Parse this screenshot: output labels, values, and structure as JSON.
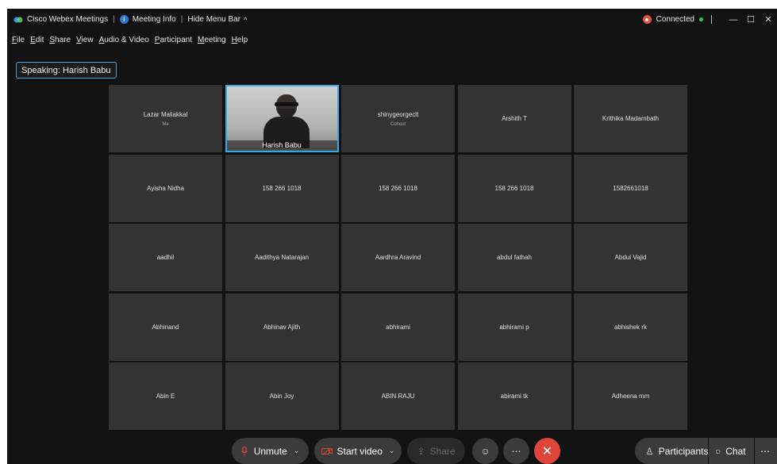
{
  "titlebar": {
    "app_name": "Cisco Webex Meetings",
    "meeting_info": "Meeting Info",
    "hide_menu": "Hide Menu Bar",
    "status": "Connected"
  },
  "menu": [
    "File",
    "Edit",
    "Share",
    "View",
    "Audio & Video",
    "Participant",
    "Meeting",
    "Help"
  ],
  "speaking_label": "Speaking: Harish Babu",
  "tiles": [
    {
      "name": "Lazar Maliakkal",
      "sub": "Me"
    },
    {
      "name": "Harish Babu",
      "sub": "",
      "video": true
    },
    {
      "name": "shinygeorgeclt",
      "sub": "Cohost"
    },
    {
      "name": "Arshith T",
      "sub": ""
    },
    {
      "name": "Krithika Madambath",
      "sub": ""
    },
    {
      "name": "Ayisha Nidha",
      "sub": ""
    },
    {
      "name": "158 266 1018",
      "sub": ""
    },
    {
      "name": "158 266 1018",
      "sub": ""
    },
    {
      "name": "158 266 1018",
      "sub": ""
    },
    {
      "name": "1582661018",
      "sub": ""
    },
    {
      "name": "aadhil",
      "sub": ""
    },
    {
      "name": "Aadithya Natarajan",
      "sub": ""
    },
    {
      "name": "Aardhra Aravind",
      "sub": ""
    },
    {
      "name": "abdul fathah",
      "sub": ""
    },
    {
      "name": "Abdul Vajid",
      "sub": ""
    },
    {
      "name": "Abhinand",
      "sub": ""
    },
    {
      "name": "Abhinav Ajith",
      "sub": ""
    },
    {
      "name": "abhirami",
      "sub": ""
    },
    {
      "name": "abhirami p",
      "sub": ""
    },
    {
      "name": "abhishek rk",
      "sub": ""
    },
    {
      "name": "Abin E",
      "sub": ""
    },
    {
      "name": "Abin Joy",
      "sub": ""
    },
    {
      "name": "ABIN RAJU",
      "sub": ""
    },
    {
      "name": "abirami tk",
      "sub": ""
    },
    {
      "name": "Adheena mm",
      "sub": ""
    }
  ],
  "controls": {
    "unmute": "Unmute",
    "start_video": "Start video",
    "share": "Share",
    "participants": "Participants",
    "chat": "Chat"
  },
  "colors": {
    "background": "#121212",
    "tile": "#333333",
    "active_border": "#39a8e6",
    "end_call": "#e0453c",
    "connected": "#37c25a"
  }
}
